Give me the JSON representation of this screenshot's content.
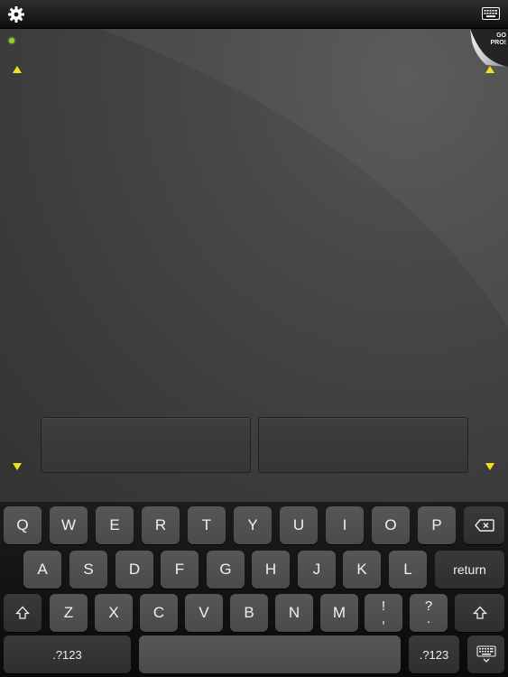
{
  "topbar": {
    "settings_icon": "gear-icon",
    "keyboard_icon": "keyboard-icon"
  },
  "trackpad": {
    "status_color": "#8bd12a",
    "arrow_color": "#f3e21a",
    "promo": {
      "line1": "GO",
      "line2": "PRO!"
    }
  },
  "keyboard": {
    "row1": [
      "Q",
      "W",
      "E",
      "R",
      "T",
      "Y",
      "U",
      "I",
      "O",
      "P"
    ],
    "row2": [
      "A",
      "S",
      "D",
      "F",
      "G",
      "H",
      "J",
      "K",
      "L"
    ],
    "row3": [
      "Z",
      "X",
      "C",
      "V",
      "B",
      "N",
      "M"
    ],
    "return_label": "return",
    "numbers_label": ".?123",
    "exclaim_top": "!",
    "exclaim_bottom": ",",
    "question_top": "?",
    "question_bottom": "."
  }
}
